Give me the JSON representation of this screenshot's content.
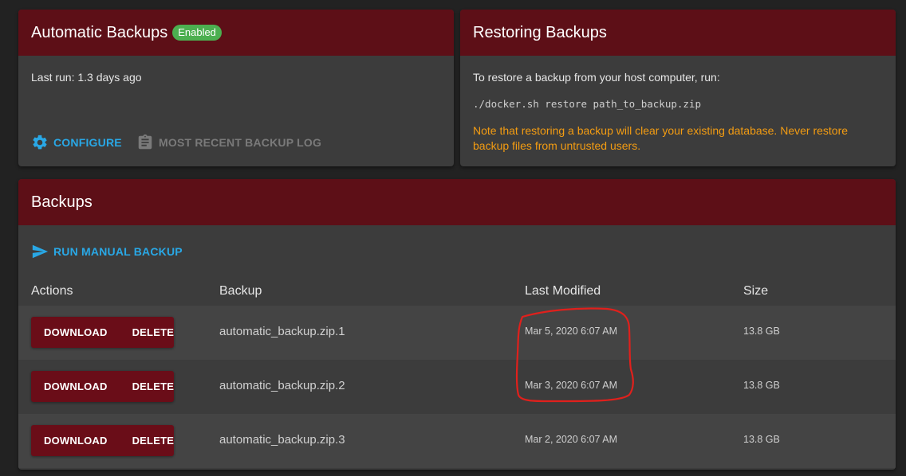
{
  "auto_backups": {
    "title": "Automatic Backups",
    "badge": "Enabled",
    "last_run": "Last run: 1.3 days ago",
    "configure_label": "CONFIGURE",
    "log_label": "MOST RECENT BACKUP LOG"
  },
  "restoring": {
    "title": "Restoring Backups",
    "instruction": "To restore a backup from your host computer, run:",
    "command": "./docker.sh restore path_to_backup.zip",
    "warning": "Note that restoring a backup will clear your existing database. Never restore backup files from untrusted users."
  },
  "backups": {
    "title": "Backups",
    "run_label": "RUN MANUAL BACKUP",
    "columns": [
      "Actions",
      "Backup",
      "Last Modified",
      "Size"
    ],
    "rows": [
      {
        "download": "DOWNLOAD",
        "delete": "DELETE",
        "name": "automatic_backup.zip.1",
        "modified": "Mar 5, 2020 6:07 AM",
        "size": "13.8 GB"
      },
      {
        "download": "DOWNLOAD",
        "delete": "DELETE",
        "name": "automatic_backup.zip.2",
        "modified": "Mar 3, 2020 6:07 AM",
        "size": "13.8 GB"
      },
      {
        "download": "DOWNLOAD",
        "delete": "DELETE",
        "name": "automatic_backup.zip.3",
        "modified": "Mar 2, 2020 6:07 AM",
        "size": "13.8 GB"
      }
    ]
  },
  "colors": {
    "header": "#5d0f17",
    "accent": "#29a8e6",
    "badge": "#4caf50",
    "warning": "#f39c12",
    "annotation": "#e0201c"
  },
  "icons": [
    "gear-icon",
    "clipboard-icon",
    "send-icon"
  ]
}
